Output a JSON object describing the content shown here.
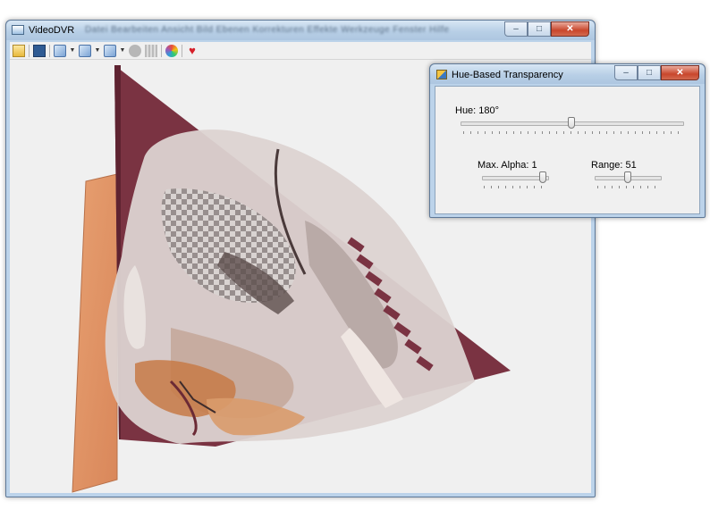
{
  "main_window": {
    "title": "VideoDVR",
    "menu_blurred": "Datei   Bearbeiten   Ansicht   Bild   Ebenen   Korrekturen   Effekte   Werkzeuge   Fenster   Hilfe",
    "buttons": {
      "minimize": "–",
      "maximize": "□",
      "close": "✕"
    }
  },
  "toolbar": {
    "icons": [
      "open-icon",
      "film-icon",
      "cube-view-icon",
      "cube-rotate-icon",
      "cube-zoom-icon",
      "gray-circle-icon",
      "grid-icon",
      "color-palette-icon",
      "heart-icon"
    ],
    "heart_glyph": "♥"
  },
  "dialog": {
    "title": "Hue-Based Transparency",
    "hue": {
      "label": "Hue: 180°",
      "value": 180,
      "min": 0,
      "max": 360
    },
    "alpha": {
      "label": "Max. Alpha: 1",
      "value": 1,
      "fraction": 1.0
    },
    "range": {
      "label": "Range: 51",
      "value": 51,
      "fraction": 0.5
    }
  },
  "colors": {
    "plane_back": "#7a3342",
    "plane_left": "#e0935f",
    "accent_close": "#c9462c"
  }
}
